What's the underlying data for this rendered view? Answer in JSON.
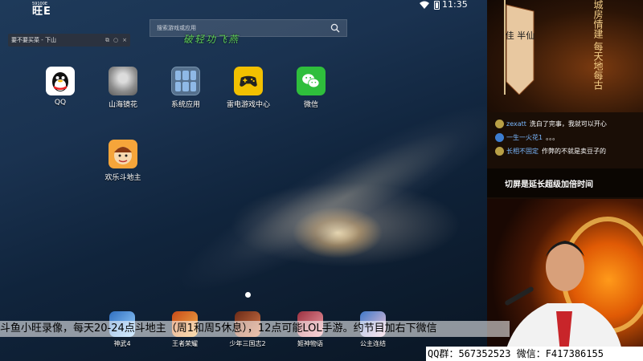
{
  "logo": {
    "small": "59100E",
    "big": "旺E"
  },
  "status_bar": {
    "time": "11:35"
  },
  "float_window": {
    "title": "要不要买菜 - 下山",
    "ctl_pin": "⧉",
    "ctl_min": "○",
    "ctl_close": "×"
  },
  "search": {
    "placeholder": "搜索游戏或应用"
  },
  "watermark": "破轻功飞燕",
  "apps": [
    {
      "label": "QQ"
    },
    {
      "label": "山海镜花"
    },
    {
      "label": "系统应用"
    },
    {
      "label": "雷电游戏中心"
    },
    {
      "label": "微信"
    },
    {
      "label": "欢乐斗地主"
    }
  ],
  "dock": [
    {
      "label": "神武4"
    },
    {
      "label": "王者荣耀"
    },
    {
      "label": "少年三国志2"
    },
    {
      "label": "姬神物语"
    },
    {
      "label": "公主连结"
    }
  ],
  "stream": {
    "banner_text": "佳 半仙",
    "calligraphy": "城房情建 每天地每古",
    "chat": [
      {
        "nick": "zexatt",
        "msg": "洗白了完事，我就可以开心"
      },
      {
        "nick": "一生一火花1",
        "msg": "。。。"
      },
      {
        "nick": "长相不固定",
        "msg": "作弊的不就是卖豆子的"
      }
    ],
    "notice": "切屏是延长超级加倍时间",
    "ticker": "斗鱼小旺录像，每天20-24点斗地主（周1和周5休息），12点可能LOL手游。约节目加右下微信",
    "contact": "QQ群：567352523 微信：F417386155"
  },
  "colors": {
    "watermark": "#5fd05a",
    "chat_nick": "#7ab8ff",
    "wechat": "#2fbe3c",
    "leidian": "#f2c000"
  }
}
